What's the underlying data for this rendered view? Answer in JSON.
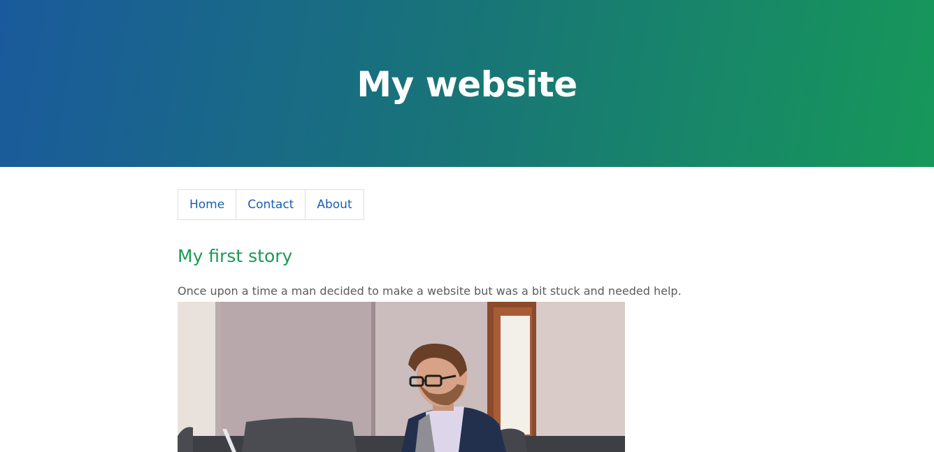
{
  "header": {
    "title": "My website"
  },
  "nav": {
    "items": [
      {
        "label": "Home"
      },
      {
        "label": "Contact"
      },
      {
        "label": "About"
      }
    ]
  },
  "story": {
    "title": "My first story",
    "text": "Once upon a time a man decided to make a website but was a bit stuck and needed help."
  },
  "colors": {
    "gradient_start": "#1a5a9c",
    "gradient_end": "#17985a",
    "nav_link": "#1a5fb0",
    "story_title": "#1a9a55",
    "body_text": "#5b5b5b"
  }
}
